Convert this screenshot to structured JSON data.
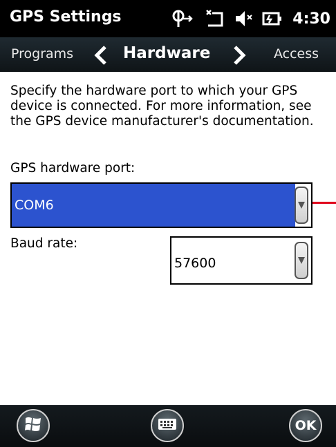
{
  "header": {
    "title": "GPS Settings",
    "time": "4:30",
    "icons": [
      "connectivity-icon",
      "signal-off-icon",
      "volume-off-icon",
      "battery-charging-icon"
    ]
  },
  "tabs": {
    "previous": "Programs",
    "current": "Hardware",
    "next": "Access"
  },
  "content": {
    "description": "Specify the hardware port to which your GPS device is connected. For more information, see the GPS device manufacturer's documentation.",
    "port_label": "GPS hardware port:",
    "port_value": "COM6",
    "baud_label": "Baud rate:",
    "baud_value": "57600"
  },
  "bottom": {
    "ok_label": "OK",
    "icons": [
      "windows-start-icon",
      "keyboard-icon"
    ]
  },
  "colors": {
    "selection": "#2c53cf",
    "annotation": "#e0001b",
    "bar": "#000000"
  }
}
